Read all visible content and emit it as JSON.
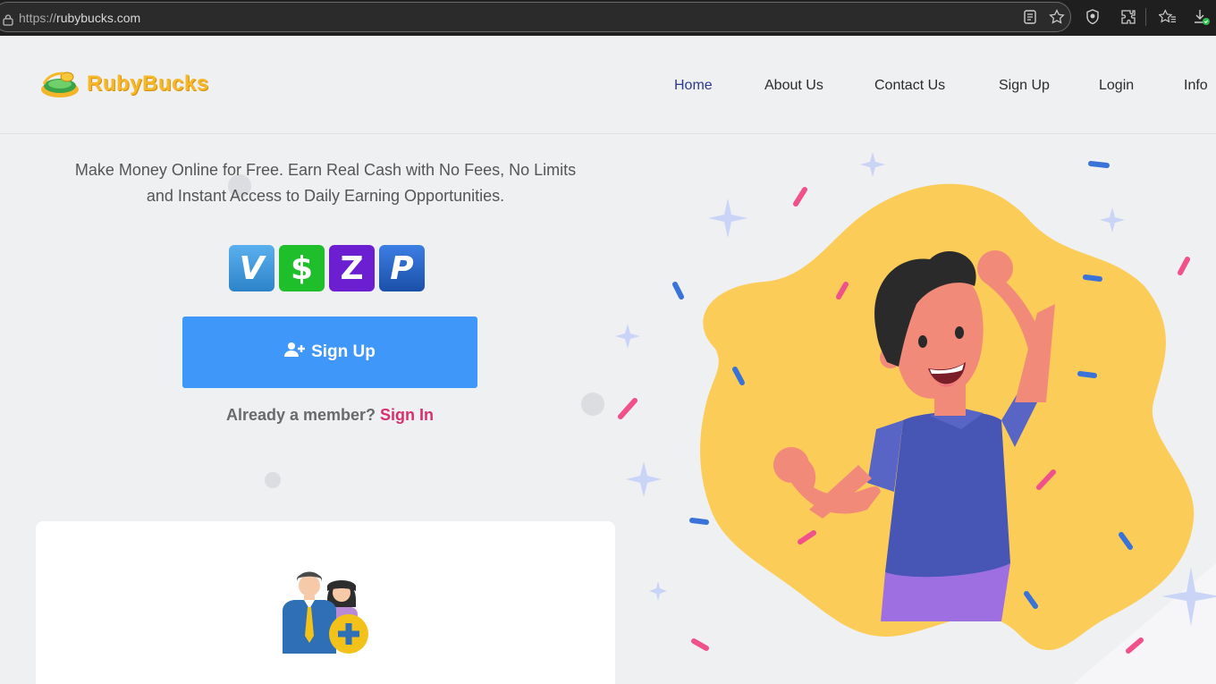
{
  "browser": {
    "url_protocol": "https://",
    "url_host": "rubybucks.com"
  },
  "brand": {
    "name": "RubyBucks",
    "color": "#f6b82b"
  },
  "nav": {
    "items": [
      {
        "label": "Home",
        "active": true
      },
      {
        "label": "About Us"
      },
      {
        "label": "Contact Us"
      },
      {
        "label": "Sign Up"
      },
      {
        "label": "Login"
      },
      {
        "label": "Info"
      }
    ]
  },
  "hero": {
    "tagline_line1": "Make Money Online for Free. Earn Real Cash with No Fees, No Limits",
    "tagline_line2": "and Instant Access to Daily Earning Opportunities.",
    "payment_methods": [
      {
        "name": "Venmo",
        "glyph": "V",
        "color": "#3d95ce"
      },
      {
        "name": "Cash App",
        "glyph": "$",
        "color": "#1fbf2b"
      },
      {
        "name": "Zelle",
        "glyph": "Z",
        "color": "#6b1fd1"
      },
      {
        "name": "PayPal",
        "glyph": "P",
        "color": "#1a4fa8"
      }
    ],
    "signup_button_label": "Sign Up",
    "member_prompt": "Already a member?",
    "signin_link": "Sign In"
  },
  "colors": {
    "accent_blue": "#4097fa",
    "link_pink": "#d8306f",
    "nav_active": "#2d3a8c"
  }
}
